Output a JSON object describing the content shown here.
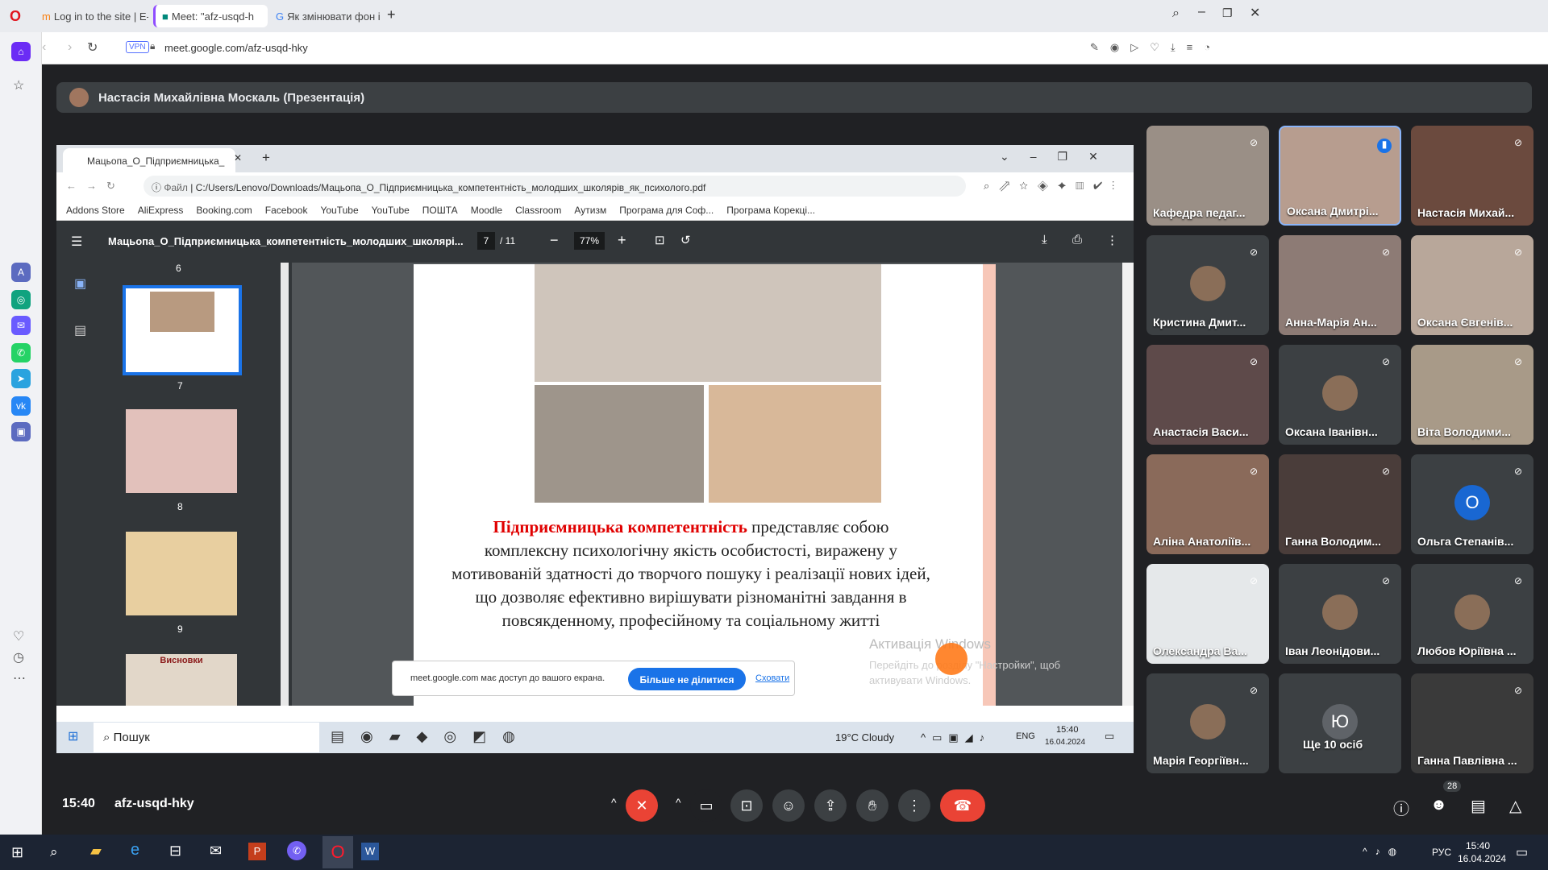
{
  "browser": {
    "tabs": [
      "Log in to the site | E-learni",
      "Meet: \"afz-usqd-h",
      "Як змінювати фон і засто"
    ],
    "url": "meet.google.com/afz-usqd-hky",
    "vpn": "VPN"
  },
  "meet": {
    "presenter": "Настасія Михайлівна Москаль (Презентація)",
    "time": "15:40",
    "code": "afz-usqd-hky",
    "participants_count": "28",
    "participants": [
      {
        "name": "Кафедра педаг...",
        "bg": "#9a8f86"
      },
      {
        "name": "Оксана Дмитрі...",
        "bg": "#b79d8f"
      },
      {
        "name": "Настасія Михай...",
        "bg": "#6b4a3e"
      },
      {
        "name": "Кристина Дмит...",
        "bg": "#3c4043"
      },
      {
        "name": "Анна-Марія Ан...",
        "bg": "#8d7b75"
      },
      {
        "name": "Оксана Євгенів...",
        "bg": "#b8a79a"
      },
      {
        "name": "Анастасія Васи...",
        "bg": "#5e4a4a"
      },
      {
        "name": "Оксана Іванівн...",
        "bg": "#3c4043"
      },
      {
        "name": "Віта Володими...",
        "bg": "#a89a88"
      },
      {
        "name": "Аліна Анатоліїв...",
        "bg": "#8a6a5a"
      },
      {
        "name": "Ганна Володим...",
        "bg": "#4a3d3a"
      },
      {
        "name": "Ольга Степанів...",
        "bg": "#3c4043",
        "initial": "О"
      },
      {
        "name": "Олександра Ва...",
        "bg": "#e5e8ea"
      },
      {
        "name": "Іван Леонідови...",
        "bg": "#3c4043"
      },
      {
        "name": "Любов Юріївна ...",
        "bg": "#3c4043"
      },
      {
        "name": "Марія Георгіївн...",
        "bg": "#3c4043"
      },
      {
        "name": "Ще 10 осіб",
        "bg": "#3c4043",
        "initial": "Ю"
      },
      {
        "name": "Ганна Павлівна ...",
        "bg": "#3a3a3a"
      }
    ]
  },
  "shared": {
    "tab_title": "Мацьопа_О_Підприємницька_",
    "file_label": "Файл",
    "path": "C:/Users/Lenovo/Downloads/Мацьопа_О_Підприємницька_компетентність_молодших_школярів_як_психолого.pdf",
    "bookmarks": [
      "Addons Store",
      "AliExpress",
      "Booking.com",
      "Facebook",
      "YouTube",
      "YouTube",
      "ПОШТА",
      "Moodle",
      "Classroom",
      "Аутизм",
      "Програма для Соф...",
      "Програма Корекці..."
    ],
    "pdf_title": "Мацьопа_О_Підприємницька_компетентність_молодших_школярі...",
    "page_current": "7",
    "page_total": "/ 11",
    "zoom": "77%",
    "thumb_numbers": [
      "6",
      "7",
      "8",
      "9"
    ],
    "thumb_last": "Висновки",
    "slide_highlight": "Підприємницька компетентність",
    "slide_text": "представляє собою комплексну психологічну якість особистості, виражену у мотивованій здатності до творчого пошуку і реалізації нових ідей, що дозволяє ефективно вирішувати різноманітні завдання в повсякденному, професійному та соціальному житті",
    "share_notice": "meet.google.com має доступ до вашого екрана.",
    "stop_share": "Більше не ділитися",
    "hide": "Сховати",
    "activate1": "Активація Windows",
    "activate2": "Перейдіть до розділу \"Настройки\", щоб",
    "activate3": "активувати Windows.",
    "search": "Пошук",
    "weather": "19°C  Cloudy",
    "lang": "ENG",
    "clock_time": "15:40",
    "clock_date": "16.04.2024"
  },
  "taskbar": {
    "lang": "РУС",
    "time": "15:40",
    "date": "16.04.2024"
  }
}
